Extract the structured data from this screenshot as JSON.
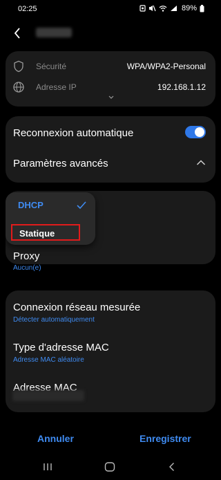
{
  "status_bar": {
    "time": "02:25",
    "battery": "89%"
  },
  "info": {
    "security_label": "Sécurité",
    "security_value": "WPA/WPA2-Personal",
    "ip_label": "Adresse IP",
    "ip_value": "192.168.1.12"
  },
  "settings": {
    "auto_reconnect_label": "Reconnexion automatique",
    "auto_reconnect_on": true,
    "advanced_label": "Paramètres avancés"
  },
  "ip_dropdown": {
    "options": [
      "DHCP",
      "Statique"
    ],
    "selected": "DHCP"
  },
  "proxy": {
    "label": "Proxy",
    "value": "Aucun(e)"
  },
  "metered": {
    "label": "Connexion réseau mesurée",
    "value": "Détecter automatiquement"
  },
  "mac_type": {
    "label": "Type d'adresse MAC",
    "value": "Adresse MAC aléatoire"
  },
  "mac_address": {
    "label": "Adresse MAC"
  },
  "footer": {
    "cancel_label": "Annuler",
    "save_label": "Enregistrer"
  },
  "colors": {
    "accent": "#3f8bf1",
    "highlight": "#e21b1b",
    "card": "#1b1b1b"
  }
}
